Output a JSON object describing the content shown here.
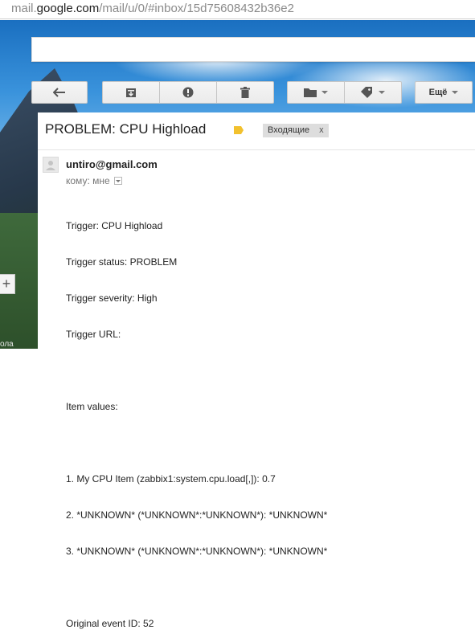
{
  "browser": {
    "url_prefix": "mail.",
    "url_host": "google.com",
    "url_path": "/mail/u/0/#inbox/15d75608432b36e2"
  },
  "toolbar": {
    "back_icon": "back-arrow-icon",
    "archive_icon": "archive-icon",
    "spam_icon": "report-spam-icon",
    "delete_icon": "trash-icon",
    "move_icon": "folder-icon",
    "labels_icon": "label-tag-icon",
    "more_label": "Ещё"
  },
  "message": {
    "subject": "PROBLEM: CPU Highload",
    "label_chip": "Входящие",
    "label_chip_close": "x",
    "sender": "untiro@gmail.com",
    "recipient": "кому: мне",
    "body_lines": [
      "Trigger: CPU Highload",
      "Trigger status: PROBLEM",
      "Trigger severity: High",
      "Trigger URL:",
      "",
      "Item values:",
      "",
      "1. My CPU Item (zabbix1:system.cpu.load[,]): 0.7",
      "2. *UNKNOWN* (*UNKNOWN*:*UNKNOWN*): *UNKNOWN*",
      "3. *UNKNOWN* (*UNKNOWN*:*UNKNOWN*): *UNKNOWN*",
      "",
      "Original event ID: 52"
    ]
  },
  "sidebar": {
    "plus_label": "+",
    "corner_text": "ола"
  },
  "colors": {
    "label_yellow": "#f2c12e",
    "chip_bg": "#dddddd",
    "toolbar_bg": "#f5f5f5"
  }
}
